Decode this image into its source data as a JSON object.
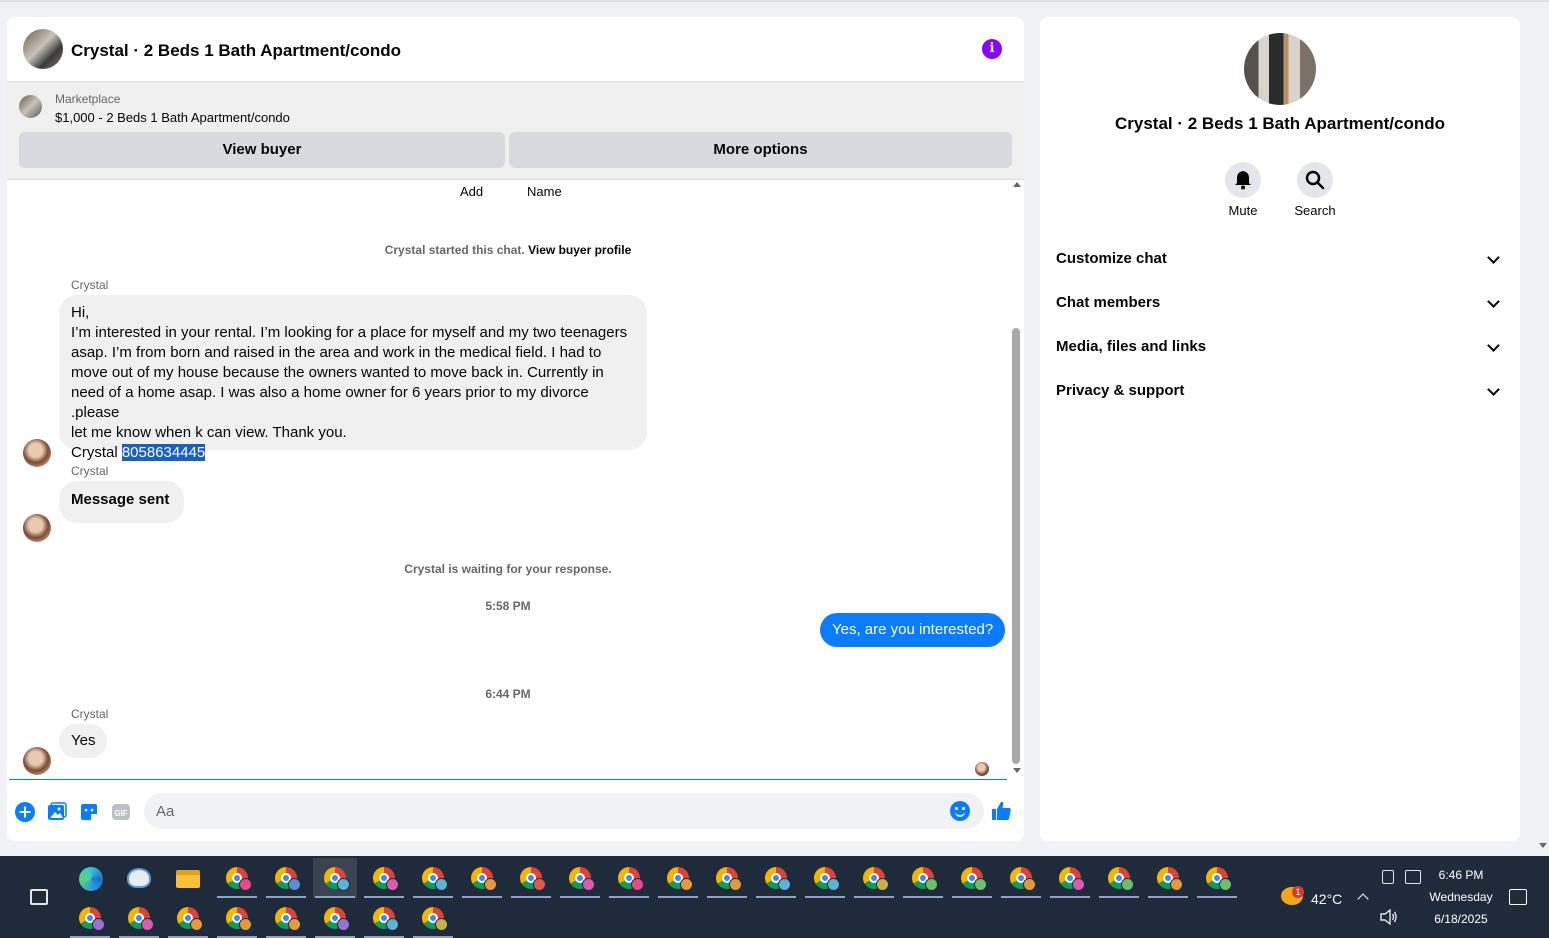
{
  "chat": {
    "title": "Crystal · 2 Beds 1 Bath Apartment/condo",
    "marketplace_label": "Marketplace",
    "listing": "$1,000 - 2 Beds 1 Bath Apartment/condo",
    "view_buyer_label": "View buyer",
    "more_options_label": "More options",
    "add_label": "Add",
    "name_label": "Name",
    "started_text": "Crystal started this chat.",
    "view_profile_link": "View buyer profile",
    "messages": [
      {
        "sender": "Crystal",
        "lines": [
          "Hi,",
          "I’m interested in your rental. I’m looking for a place for myself and my two teenagers",
          "asap. I’m from born and raised in the area and work in the medical field. I had to",
          "move out of my house because the owners wanted to move back in. Currently in",
          "need of a home asap. I was also a home owner for 6 years prior to my divorce .please",
          "let me know when k can view. Thank you."
        ],
        "sign_name": "Crystal",
        "phone": "8058634445"
      },
      {
        "sender": "Crystal",
        "text": "Message sent"
      }
    ],
    "waiting_text": "Crystal is waiting for your response.",
    "time1": "5:58 PM",
    "outgoing": "Yes, are you interested?",
    "time2": "6:44 PM",
    "last_sender": "Crystal",
    "last_message": "Yes",
    "input_placeholder": "Aa",
    "accent_color": "#0a7cff"
  },
  "details": {
    "title": "Crystal · 2 Beds 1 Bath Apartment/condo",
    "mute_label": "Mute",
    "search_label": "Search",
    "sections": [
      "Customize chat",
      "Chat members",
      "Media, files and links",
      "Privacy & support"
    ]
  },
  "taskbar": {
    "temperature": "42°C",
    "weather_badge": "1",
    "time": "6:46 PM",
    "day": "Wednesday",
    "date": "6/18/2025"
  }
}
